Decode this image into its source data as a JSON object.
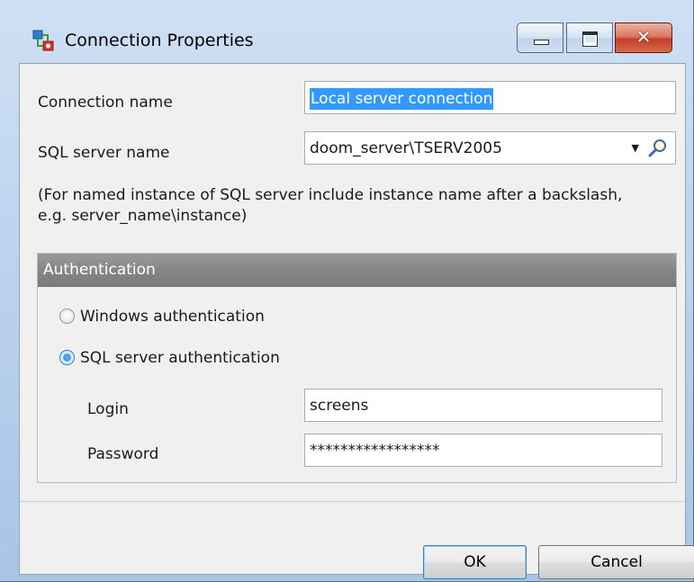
{
  "window": {
    "title": "Connection Properties",
    "controls": {
      "minimize": "minimize",
      "maximize": "maximize",
      "close": "close"
    }
  },
  "form": {
    "connection_name_label": "Connection name",
    "connection_name_value": "Local server connection",
    "server_name_label": "SQL server name",
    "server_name_value": "doom_server\\TSERV2005",
    "hint": "(For named instance of SQL server include instance name after a backslash, e.g. server_name\\instance)"
  },
  "auth": {
    "title": "Authentication",
    "options": [
      {
        "label": "Windows authentication",
        "checked": false
      },
      {
        "label": "SQL server authentication",
        "checked": true
      }
    ],
    "login_label": "Login",
    "login_value": "screens",
    "password_label": "Password",
    "password_value": "*****************"
  },
  "buttons": {
    "ok": "OK",
    "cancel": "Cancel"
  },
  "colors": {
    "selection": "#3399ff",
    "titlebar": "#bcd3ee",
    "close": "#c4402a"
  }
}
